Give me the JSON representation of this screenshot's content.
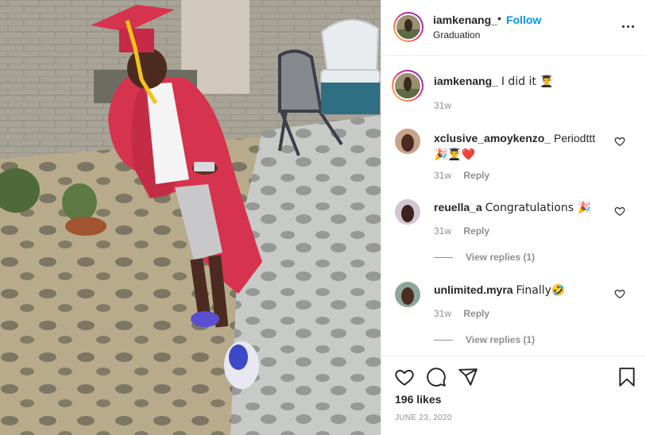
{
  "post": {
    "username": "iamkenang_",
    "separator": "•",
    "follow_label": "Follow",
    "location": "Graduation",
    "caption": "I did it 👨‍🎓",
    "caption_time": "31w"
  },
  "comments": [
    {
      "username": "xclusive_amoykenzo_",
      "text": "Periodttt",
      "text2": "🎉👨‍🎓❤️",
      "time": "31w",
      "reply_label": "Reply"
    },
    {
      "username": "reuella_a",
      "text": "Congratulations 🎉",
      "time": "31w",
      "reply_label": "Reply",
      "view_replies": "View replies (1)"
    },
    {
      "username": "unlimited.myra",
      "text": "Finally🤣",
      "time": "31w",
      "reply_label": "Reply",
      "view_replies": "View replies (1)"
    }
  ],
  "actions": {
    "likes": "196 likes",
    "date": "JUNE 23, 2020",
    "icons": [
      "heart-icon",
      "comment-icon",
      "share-icon",
      "bookmark-icon"
    ]
  },
  "colors": {
    "accent": "#0095f6",
    "text": "#262626",
    "muted": "#8e8e8e",
    "gown": "#d6334f"
  }
}
